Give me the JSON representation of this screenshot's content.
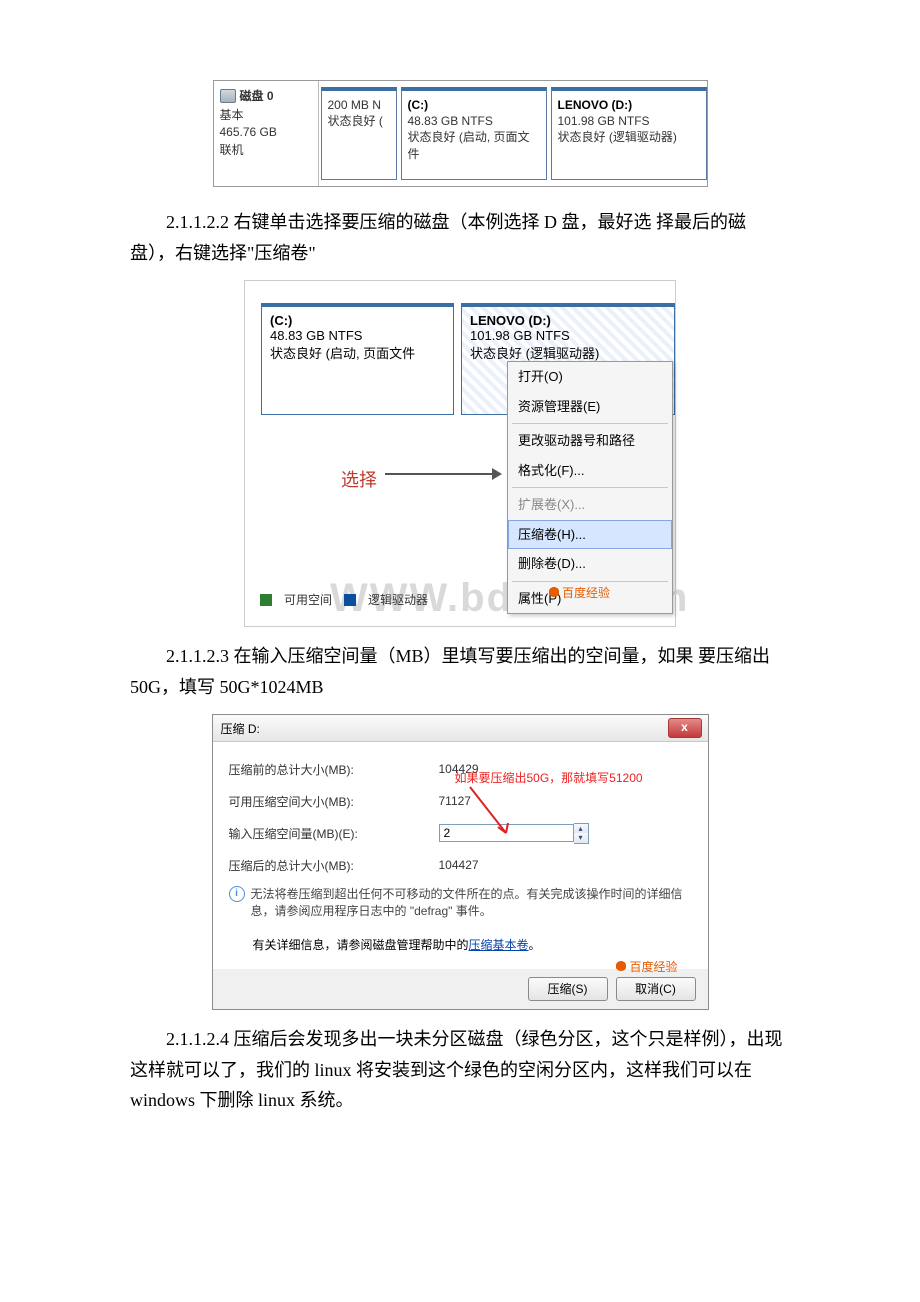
{
  "diskStrip": {
    "left": {
      "name": "磁盘 0",
      "type": "基本",
      "size": "465.76 GB",
      "status": "联机"
    },
    "part1": {
      "header": "",
      "size": "200 MB N",
      "status": "状态良好 ("
    },
    "part2": {
      "header": "(C:)",
      "size": "48.83 GB NTFS",
      "status": "状态良好 (启动, 页面文件"
    },
    "part3": {
      "header": "LENOVO  (D:)",
      "size": "101.98 GB NTFS",
      "status": "状态良好 (逻辑驱动器)"
    }
  },
  "para1": "2.1.1.2.2 右键单击选择要压缩的磁盘（本例选择 D 盘，最好选 择最后的磁盘），右键选择\"压缩卷\"",
  "ctx": {
    "leftPart": {
      "name": "(C:)",
      "size": "48.83 GB NTFS",
      "status": "状态良好 (启动, 页面文件"
    },
    "rightPart": {
      "name": "LENOVO  (D:)",
      "size": "101.98 GB NTFS",
      "status": "状态良好 (逻辑驱动器)"
    },
    "selectLabel": "选择",
    "menu": {
      "open": "打开(O)",
      "explorer": "资源管理器(E)",
      "change": "更改驱动器号和路径",
      "format": "格式化(F)...",
      "extend": "扩展卷(X)...",
      "shrink": "压缩卷(H)...",
      "delete": "删除卷(D)...",
      "prop": "属性(P)"
    },
    "legend": {
      "avail": "可用空间",
      "logical": "逻辑驱动器"
    },
    "watermark": "WWW.bdocx.com",
    "baidu": "百度经验"
  },
  "para2": "2.1.1.2.3 在输入压缩空间量（MB）里填写要压缩出的空间量，如果 要压缩出 50G，填写 50G*1024MB",
  "dlg": {
    "title": "压缩 D:",
    "l1": "压缩前的总计大小(MB):",
    "v1": "104429",
    "l2": "可用压缩空间大小(MB):",
    "v2raw": "71127",
    "callout": "如果要压缩出50G，那就填写51200",
    "l3": "输入压缩空间量(MB)(E):",
    "v3": "2",
    "l4": "压缩后的总计大小(MB):",
    "v4": "104427",
    "note": "无法将卷压缩到超出任何不可移动的文件所在的点。有关完成该操作时间的详细信息，请参阅应用程序日志中的 \"defrag\" 事件。",
    "help_pre": "有关详细信息，请参阅磁盘管理帮助中的",
    "help_link": "压缩基本卷",
    "help_post": "。",
    "btn_ok": "压缩(S)",
    "btn_cancel": "取消(C)",
    "baidu": "百度经验"
  },
  "para3": "2.1.1.2.4 压缩后会发现多出一块未分区磁盘（绿色分区，这个只是样例），出现这样就可以了，我们的 linux 将安装到这个绿色的空闲分区内，这样我们可以在 windows 下删除 linux 系统。"
}
